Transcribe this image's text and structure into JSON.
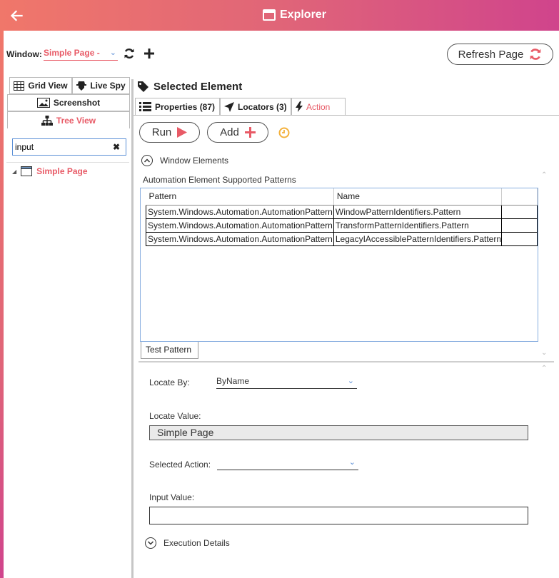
{
  "titlebar": {
    "title": "Explorer"
  },
  "window_bar": {
    "label": "Window:",
    "selected_window": "Simple Page -",
    "refresh_label": "Refresh Page"
  },
  "left_tabs": {
    "grid_view": "Grid View",
    "live_spy": "Live Spy",
    "screenshot": "Screenshot",
    "tree_view": "Tree View"
  },
  "search": {
    "value": "input"
  },
  "tree": {
    "items": [
      {
        "label": "Simple Page"
      }
    ]
  },
  "selected_element": {
    "title": "Selected Element",
    "tabs": {
      "properties": "Properties (87)",
      "locators": "Locators (3)",
      "action": "Action"
    },
    "run_label": "Run",
    "add_label": "Add",
    "window_elements_label": "Window Elements",
    "patterns_label": "Automation Element Supported Patterns",
    "patterns_table": {
      "headers": [
        "Pattern",
        "Name"
      ],
      "rows": [
        [
          "System.Windows.Automation.AutomationPattern",
          "WindowPatternIdentifiers.Pattern"
        ],
        [
          "System.Windows.Automation.AutomationPattern",
          "TransformPatternIdentifiers.Pattern"
        ],
        [
          "System.Windows.Automation.AutomationPattern",
          "LegacyIAccessiblePatternIdentifiers.Pattern"
        ]
      ]
    },
    "test_pattern_label": "Test Pattern",
    "locate_by_label": "Locate By:",
    "locate_by_value": "ByName",
    "locate_value_label": "Locate Value:",
    "locate_value": "Simple Page",
    "selected_action_label": "Selected Action:",
    "selected_action_value": "",
    "input_value_label": "Input Value:",
    "input_value": "",
    "execution_details_label": "Execution Details"
  },
  "colors": {
    "accent": "#e85a66",
    "titlebar_start": "#f0776a",
    "titlebar_end": "#d0448c",
    "link_blue": "#5b8fd6",
    "clock": "#f4b13b"
  }
}
